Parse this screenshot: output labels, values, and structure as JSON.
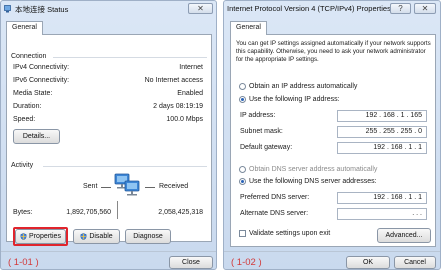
{
  "left_window": {
    "title": "本地连接 Status",
    "close_glyph": "✕",
    "tab": "General",
    "connection": {
      "heading": "Connection",
      "rows": [
        {
          "label": "IPv4 Connectivity:",
          "value": "Internet"
        },
        {
          "label": "IPv6 Connectivity:",
          "value": "No Internet access"
        },
        {
          "label": "Media State:",
          "value": "Enabled"
        },
        {
          "label": "Duration:",
          "value": "2 days 08:19:19"
        },
        {
          "label": "Speed:",
          "value": "100.0 Mbps"
        }
      ],
      "details_button": "Details..."
    },
    "activity": {
      "heading": "Activity",
      "sent_label": "Sent",
      "received_label": "Received",
      "bytes_label": "Bytes:",
      "bytes_sent": "1,892,705,560",
      "bytes_received": "2,058,425,318"
    },
    "buttons": {
      "properties": "Properties",
      "disable": "Disable",
      "diagnose": "Diagnose",
      "close": "Close"
    },
    "caption": "( 1-01 )"
  },
  "right_window": {
    "title": "Internet Protocol Version 4 (TCP/IPv4) Properties",
    "help_glyph": "?",
    "close_glyph": "✕",
    "tab": "General",
    "description": [
      "You can get IP settings assigned automatically if your network supports",
      "this capability. Otherwise, you need to ask your network administrator",
      "for the appropriate IP settings."
    ],
    "ip_options": {
      "auto": "Obtain an IP address automatically",
      "manual": "Use the following IP address:",
      "selected": "manual"
    },
    "ip_fields": [
      {
        "label": "IP address:",
        "value": "192 . 168 .  1  . 165"
      },
      {
        "label": "Subnet mask:",
        "value": "255 . 255 . 255 .  0"
      },
      {
        "label": "Default gateway:",
        "value": "192 . 168 .  1  .  1"
      }
    ],
    "dns_options": {
      "auto": "Obtain DNS server address automatically",
      "manual": "Use the following DNS server addresses:",
      "selected": "manual"
    },
    "dns_fields": [
      {
        "label": "Preferred DNS server:",
        "value": "192 . 168 .  1  .  1"
      },
      {
        "label": "Alternate DNS server:",
        "value": ".        .        ."
      }
    ],
    "validate_label": "Validate settings upon exit",
    "validate_checked": false,
    "buttons": {
      "advanced": "Advanced...",
      "ok": "OK",
      "cancel": "Cancel"
    },
    "caption": "( 1-02 )"
  },
  "colors": {
    "highlight": "#e0242c",
    "caption": "#d23a3a",
    "title_bar": "#d4e2f4"
  }
}
